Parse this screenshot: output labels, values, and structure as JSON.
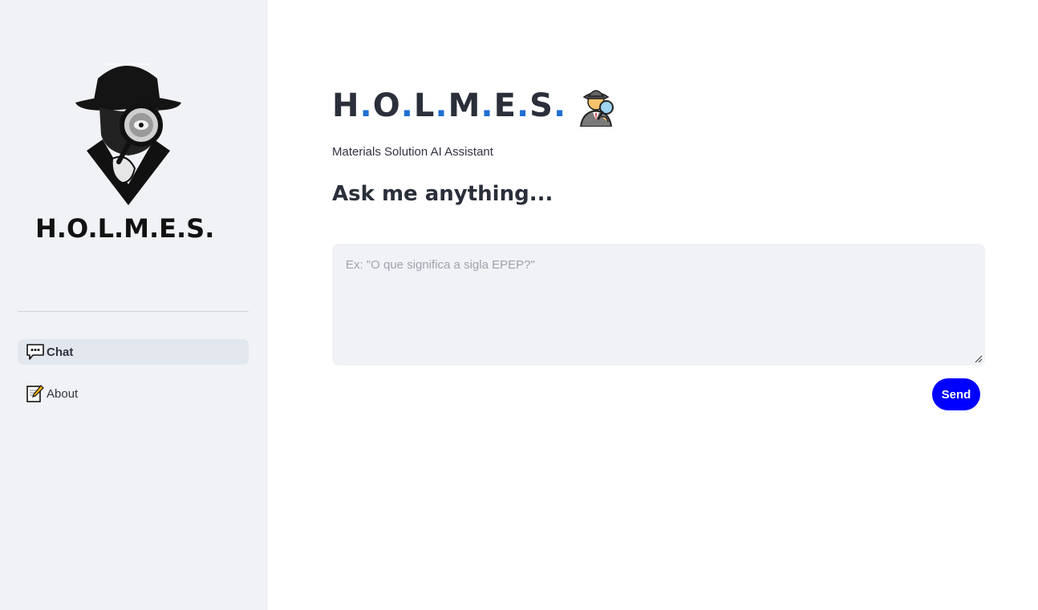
{
  "sidebar": {
    "logo_text": "H.O.L.M.E.S.",
    "nav": [
      {
        "label": "Chat",
        "icon": "speech-balloon-icon",
        "active": true
      },
      {
        "label": "About",
        "icon": "memo-icon",
        "active": false
      }
    ]
  },
  "main": {
    "title_parts": [
      "H",
      ".",
      "O",
      ".",
      "L",
      ".",
      "M",
      ".",
      "E",
      ".",
      "S",
      "."
    ],
    "title_emoji": "detective-icon",
    "subtitle": "Materials Solution AI Assistant",
    "heading": "Ask me anything...",
    "input": {
      "placeholder": "Ex: \"O que significa a sigla EPEP?\"",
      "value": ""
    },
    "send_label": "Send"
  },
  "colors": {
    "sidebar_bg": "#f0f2f6",
    "accent_dot": "#1f6fd1",
    "send_button": "#0000ff"
  }
}
